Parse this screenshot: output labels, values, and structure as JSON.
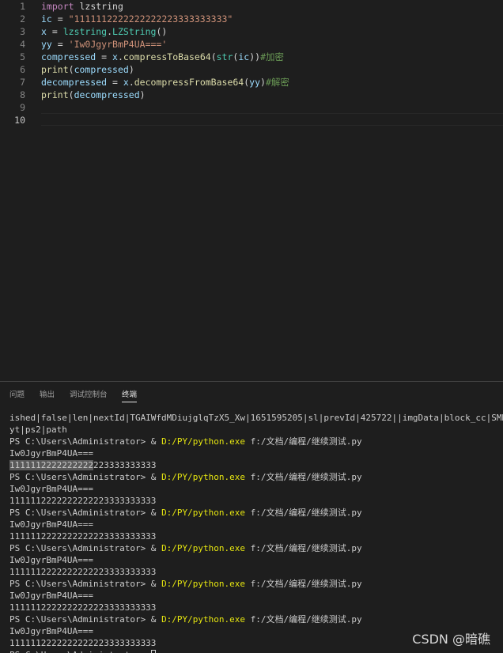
{
  "editor": {
    "lines": [
      {
        "num": "1",
        "tokens": [
          {
            "t": "import",
            "c": "kw"
          },
          {
            "t": " ",
            "c": "op"
          },
          {
            "t": "lzstring",
            "c": "op"
          }
        ]
      },
      {
        "num": "2",
        "tokens": [
          {
            "t": "ic",
            "c": "var"
          },
          {
            "t": " = ",
            "c": "op"
          },
          {
            "t": "\"1111112222222222223333333333\"",
            "c": "str"
          }
        ]
      },
      {
        "num": "3",
        "tokens": [
          {
            "t": "x",
            "c": "var"
          },
          {
            "t": " = ",
            "c": "op"
          },
          {
            "t": "lzstring",
            "c": "cls"
          },
          {
            "t": ".",
            "c": "op"
          },
          {
            "t": "LZString",
            "c": "cls"
          },
          {
            "t": "()",
            "c": "op"
          }
        ]
      },
      {
        "num": "4",
        "tokens": [
          {
            "t": "yy",
            "c": "var"
          },
          {
            "t": " = ",
            "c": "op"
          },
          {
            "t": "'Iw0JgyrBmP4UA==='",
            "c": "str"
          }
        ]
      },
      {
        "num": "5",
        "tokens": [
          {
            "t": "compressed",
            "c": "var"
          },
          {
            "t": " = ",
            "c": "op"
          },
          {
            "t": "x",
            "c": "var"
          },
          {
            "t": ".",
            "c": "op"
          },
          {
            "t": "compressToBase64",
            "c": "fn"
          },
          {
            "t": "(",
            "c": "op"
          },
          {
            "t": "str",
            "c": "cls"
          },
          {
            "t": "(",
            "c": "op"
          },
          {
            "t": "ic",
            "c": "var"
          },
          {
            "t": "))",
            "c": "op"
          },
          {
            "t": "#加密",
            "c": "cm"
          }
        ]
      },
      {
        "num": "6",
        "tokens": [
          {
            "t": "print",
            "c": "fn"
          },
          {
            "t": "(",
            "c": "op"
          },
          {
            "t": "compressed",
            "c": "var"
          },
          {
            "t": ")",
            "c": "op"
          }
        ]
      },
      {
        "num": "7",
        "tokens": [
          {
            "t": "decompressed",
            "c": "var"
          },
          {
            "t": " = ",
            "c": "op"
          },
          {
            "t": "x",
            "c": "var"
          },
          {
            "t": ".",
            "c": "op"
          },
          {
            "t": "decompressFromBase64",
            "c": "fn"
          },
          {
            "t": "(",
            "c": "op"
          },
          {
            "t": "yy",
            "c": "var"
          },
          {
            "t": ")",
            "c": "op"
          },
          {
            "t": "#解密",
            "c": "cm"
          }
        ]
      },
      {
        "num": "8",
        "tokens": [
          {
            "t": "print",
            "c": "fn"
          },
          {
            "t": "(",
            "c": "op"
          },
          {
            "t": "decompressed",
            "c": "var"
          },
          {
            "t": ")",
            "c": "op"
          }
        ]
      },
      {
        "num": "9",
        "tokens": []
      },
      {
        "num": "10",
        "tokens": [],
        "active": true
      }
    ]
  },
  "panel": {
    "tabs": [
      {
        "label": "问题",
        "active": false
      },
      {
        "label": "输出",
        "active": false
      },
      {
        "label": "调试控制台",
        "active": false
      },
      {
        "label": "终端",
        "active": true
      }
    ]
  },
  "terminal": {
    "lines": [
      [
        {
          "t": "ished|false|len|nextId|TGAIWfdMDiujglqTzX5_Xw|1651595205|sl|prevId|425722||imgData|block_cc|SMH|status|j"
        }
      ],
      [
        {
          "t": "yt|ps2|path"
        }
      ],
      [
        {
          "t": "PS C:\\Users\\Administrator> & "
        },
        {
          "t": "D:/PY/python.exe",
          "c": "exe"
        },
        {
          "t": " f:/文档/编程/继续测试.py"
        }
      ],
      [
        {
          "t": "Iw0JgyrBmP4UA==="
        }
      ],
      [
        {
          "t": "1111112222222222",
          "c": "sel"
        },
        {
          "t": "223333333333"
        }
      ],
      [
        {
          "t": "PS C:\\Users\\Administrator> & "
        },
        {
          "t": "D:/PY/python.exe",
          "c": "exe"
        },
        {
          "t": " f:/文档/编程/继续测试.py"
        }
      ],
      [
        {
          "t": "Iw0JgyrBmP4UA==="
        }
      ],
      [
        {
          "t": "1111112222222222223333333333"
        }
      ],
      [
        {
          "t": "PS C:\\Users\\Administrator> & "
        },
        {
          "t": "D:/PY/python.exe",
          "c": "exe"
        },
        {
          "t": " f:/文档/编程/继续测试.py"
        }
      ],
      [
        {
          "t": "Iw0JgyrBmP4UA==="
        }
      ],
      [
        {
          "t": "1111112222222222223333333333"
        }
      ],
      [
        {
          "t": "PS C:\\Users\\Administrator> & "
        },
        {
          "t": "D:/PY/python.exe",
          "c": "exe"
        },
        {
          "t": " f:/文档/编程/继续测试.py"
        }
      ],
      [
        {
          "t": "Iw0JgyrBmP4UA==="
        }
      ],
      [
        {
          "t": "1111112222222222223333333333"
        }
      ],
      [
        {
          "t": "PS C:\\Users\\Administrator> & "
        },
        {
          "t": "D:/PY/python.exe",
          "c": "exe"
        },
        {
          "t": " f:/文档/编程/继续测试.py"
        }
      ],
      [
        {
          "t": "Iw0JgyrBmP4UA==="
        }
      ],
      [
        {
          "t": "1111112222222222223333333333"
        }
      ],
      [
        {
          "t": "PS C:\\Users\\Administrator> & "
        },
        {
          "t": "D:/PY/python.exe",
          "c": "exe"
        },
        {
          "t": " f:/文档/编程/继续测试.py"
        }
      ],
      [
        {
          "t": "Iw0JgyrBmP4UA==="
        }
      ],
      [
        {
          "t": "1111112222222222223333333333"
        }
      ],
      [
        {
          "t": "PS C:\\Users\\Administrator> "
        },
        {
          "t": "",
          "c": "cursor"
        }
      ]
    ]
  },
  "watermark": "CSDN @暗礁"
}
